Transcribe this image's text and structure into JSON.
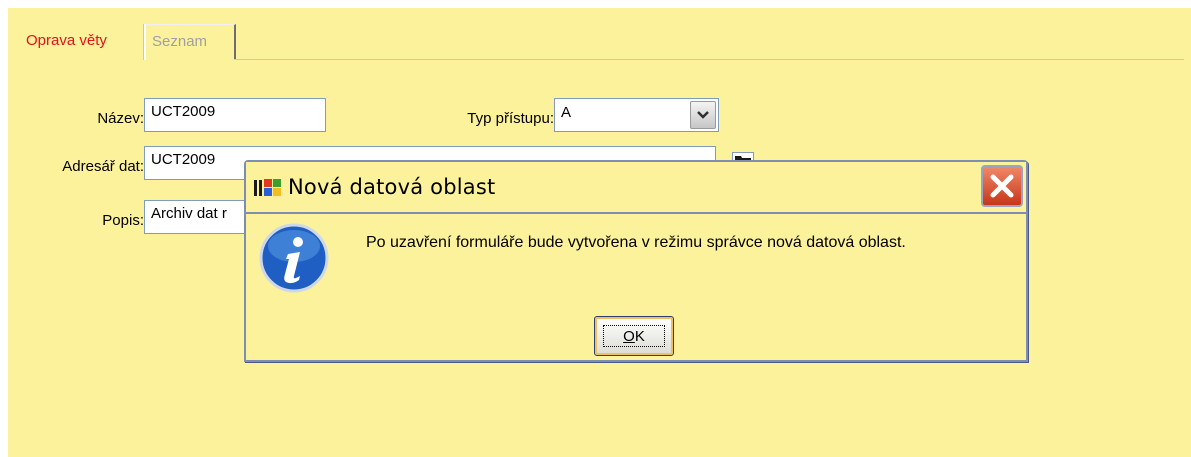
{
  "tabs": [
    {
      "label": "Oprava věty",
      "active": true
    },
    {
      "label": "Seznam",
      "active": false
    }
  ],
  "form": {
    "name_label": "Název:",
    "name_value": "UCT2009",
    "access_label": "Typ přístupu:",
    "access_value": "A",
    "dir_label": "Adresář dat:",
    "dir_value": "UCT2009",
    "desc_label": "Popis:",
    "desc_value": "Archiv dat r"
  },
  "dialog": {
    "title": "Nová datová oblast",
    "message": "Po uzavření formuláře bude vytvořena v režimu správce nová datová oblast.",
    "ok_mnemonic": "O",
    "ok_rest": "K",
    "icons": {
      "app": "windows-flag-icon",
      "close": "close-icon",
      "info": "info-icon"
    }
  },
  "colors": {
    "background": "#fdf29c",
    "active_tab": "#e0141c",
    "inactive_tab": "#a0a0a0",
    "dialog_border": "#7d8eb2",
    "close_button": "#d8502e"
  }
}
